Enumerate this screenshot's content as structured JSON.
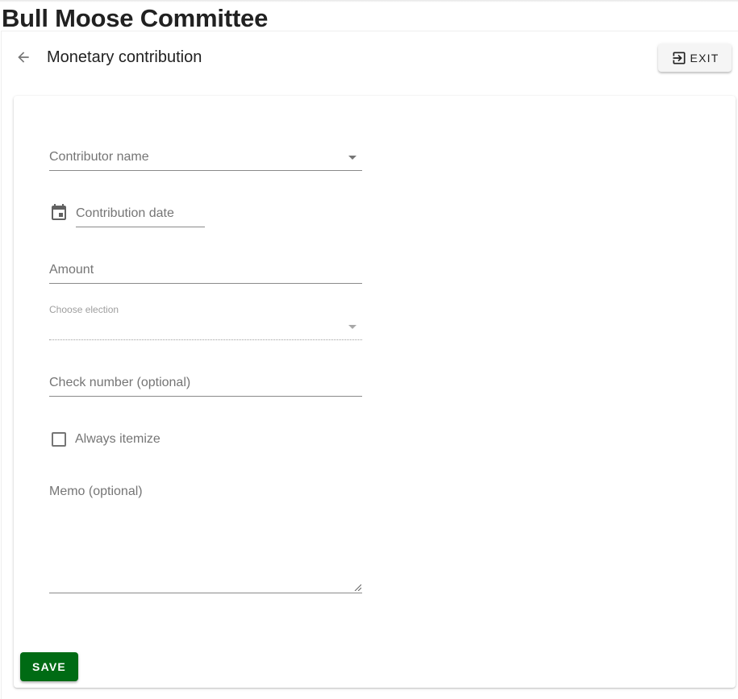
{
  "header": {
    "org_title": "Bull Moose Committee",
    "page_title": "Monetary contribution",
    "exit_label": "EXIT"
  },
  "form": {
    "contributor_name": {
      "label": "Contributor name",
      "value": ""
    },
    "contribution_date": {
      "label": "Contribution date",
      "value": ""
    },
    "amount": {
      "label": "Amount",
      "value": ""
    },
    "election": {
      "label": "Choose election",
      "value": "",
      "disabled": true
    },
    "check_number": {
      "label": "Check number (optional)",
      "value": ""
    },
    "always_itemize": {
      "label": "Always itemize",
      "checked": false
    },
    "memo": {
      "label": "Memo (optional)",
      "value": ""
    }
  },
  "actions": {
    "save_label": "SAVE"
  },
  "colors": {
    "save_button": "#006b14",
    "text_primary": "#212121",
    "text_secondary": "#757575"
  },
  "icons": {
    "back": "arrow-left-icon",
    "exit": "exit-to-app-icon",
    "date": "calendar-icon",
    "dropdown": "arrow-drop-down-icon"
  }
}
